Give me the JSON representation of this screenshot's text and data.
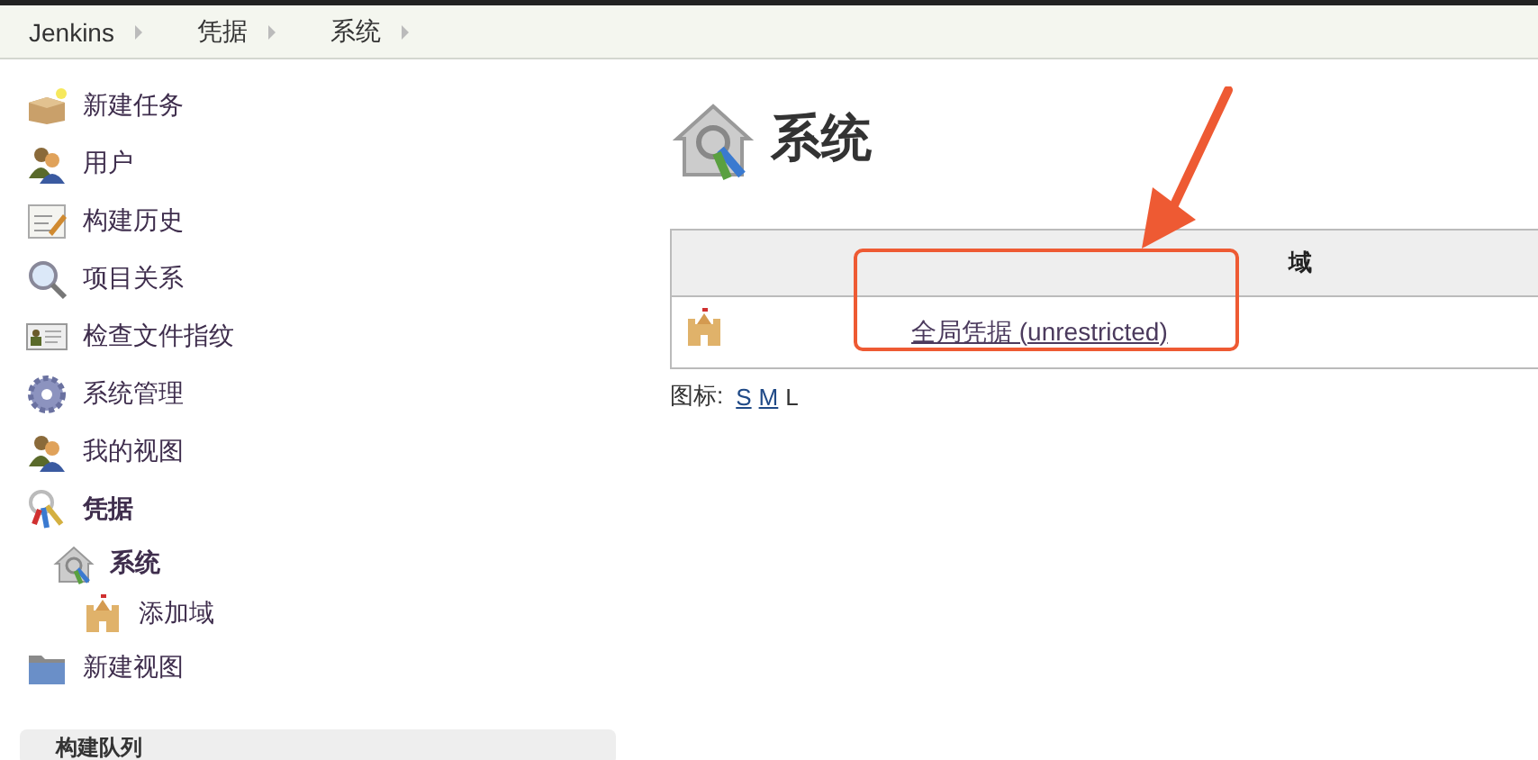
{
  "breadcrumbs": [
    {
      "label": "Jenkins"
    },
    {
      "label": "凭据"
    },
    {
      "label": "系统"
    }
  ],
  "sidebar": {
    "items": [
      {
        "label": "新建任务",
        "selected": false
      },
      {
        "label": "用户",
        "selected": false
      },
      {
        "label": "构建历史",
        "selected": false
      },
      {
        "label": "项目关系",
        "selected": false
      },
      {
        "label": "检查文件指纹",
        "selected": false
      },
      {
        "label": "系统管理",
        "selected": false
      },
      {
        "label": "我的视图",
        "selected": false
      },
      {
        "label": "凭据",
        "selected": true,
        "children": [
          {
            "label": "系统",
            "selected": true,
            "children": [
              {
                "label": "添加域",
                "selected": false
              }
            ]
          }
        ]
      },
      {
        "label": "新建视图",
        "selected": false
      }
    ]
  },
  "queue_panel": {
    "title": "构建队列"
  },
  "page": {
    "title": "系统"
  },
  "table": {
    "columns": [
      "域"
    ],
    "rows": [
      {
        "link": "全局凭据 (unrestricted)"
      }
    ]
  },
  "icon_size": {
    "label": "图标:",
    "options": [
      {
        "label": "S",
        "selected": false
      },
      {
        "label": "M",
        "selected": false
      },
      {
        "label": "L",
        "selected": true
      }
    ]
  }
}
